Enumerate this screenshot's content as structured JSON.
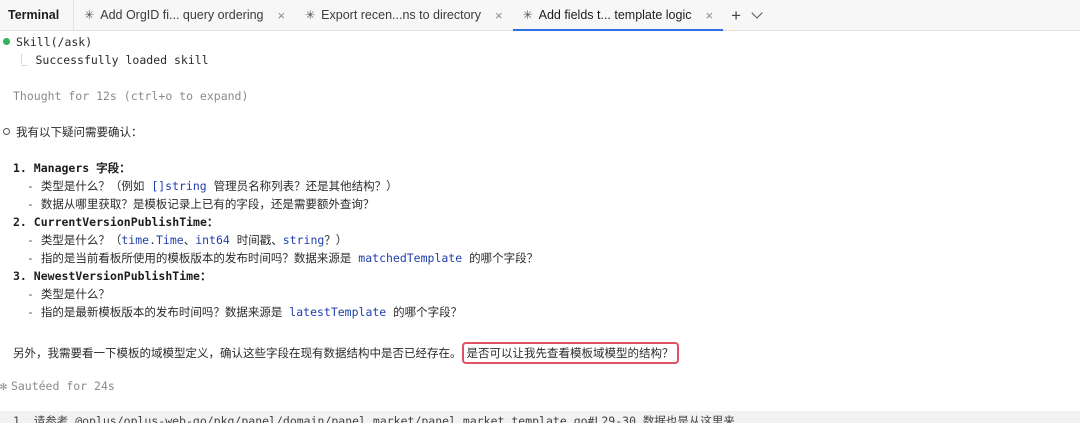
{
  "tabbar": {
    "terminal_label": "Terminal",
    "tabs": [
      {
        "label": "Add OrgID fi... query ordering",
        "close": "×"
      },
      {
        "label": "Export recen...ns to directory",
        "close": "×"
      },
      {
        "label": "Add fields t... template logic",
        "close": "×"
      }
    ],
    "new_tab": "+",
    "active_tab_index": 2
  },
  "terminal": {
    "skill_line": "Skill(/ask)",
    "skill_result": "Successfully loaded skill",
    "thought": "Thought for 12s (ctrl+o to expand)",
    "intro": "我有以下疑问需要确认：",
    "q1_num": "1.",
    "q1_field": "Managers",
    "q1_suffix": " 字段：",
    "q1_a_pre": "类型是什么？（例如 ",
    "q1_a_code": "[]string",
    "q1_a_post": " 管理员名称列表？还是其他结构？）",
    "q1_b": "数据从哪里获取？是模板记录上已有的字段，还是需要额外查询？",
    "q2_num": "2.",
    "q2_field": "CurrentVersionPublishTime",
    "q2_suffix": "：",
    "q2_a_pre": "类型是什么？（",
    "q2_a_code1": "time.Time",
    "q2_a_mid": "、",
    "q2_a_code2": "int64",
    "q2_a_mid2": " 时间戳、",
    "q2_a_code3": "string",
    "q2_a_post": "？）",
    "q2_b_pre": "指的是当前看板所使用的模板版本的发布时间吗？数据来源是 ",
    "q2_b_code": "matchedTemplate",
    "q2_b_post": " 的哪个字段？",
    "q3_num": "3.",
    "q3_field": "NewestVersionPublishTime",
    "q3_suffix": "：",
    "q3_a": "类型是什么？",
    "q3_b_pre": "指的是最新模板版本的发布时间吗？数据来源是 ",
    "q3_b_code": "latestTemplate",
    "q3_b_post": " 的哪个字段？",
    "dash": "-",
    "final_pre": "另外，我需要看一下模板的域模型定义，确认这些字段在现有数据结构中是否已经存在。",
    "final_highlight": "是否可以让我先查看模板域模型的结构？",
    "sauteed": "Sautéed for 24s",
    "bottom": "1. 请参考 @oplus/oplus-web-go/pkg/panel/domain/panel_market/panel_market_template.go#L29-30 数据也是从这里来"
  }
}
